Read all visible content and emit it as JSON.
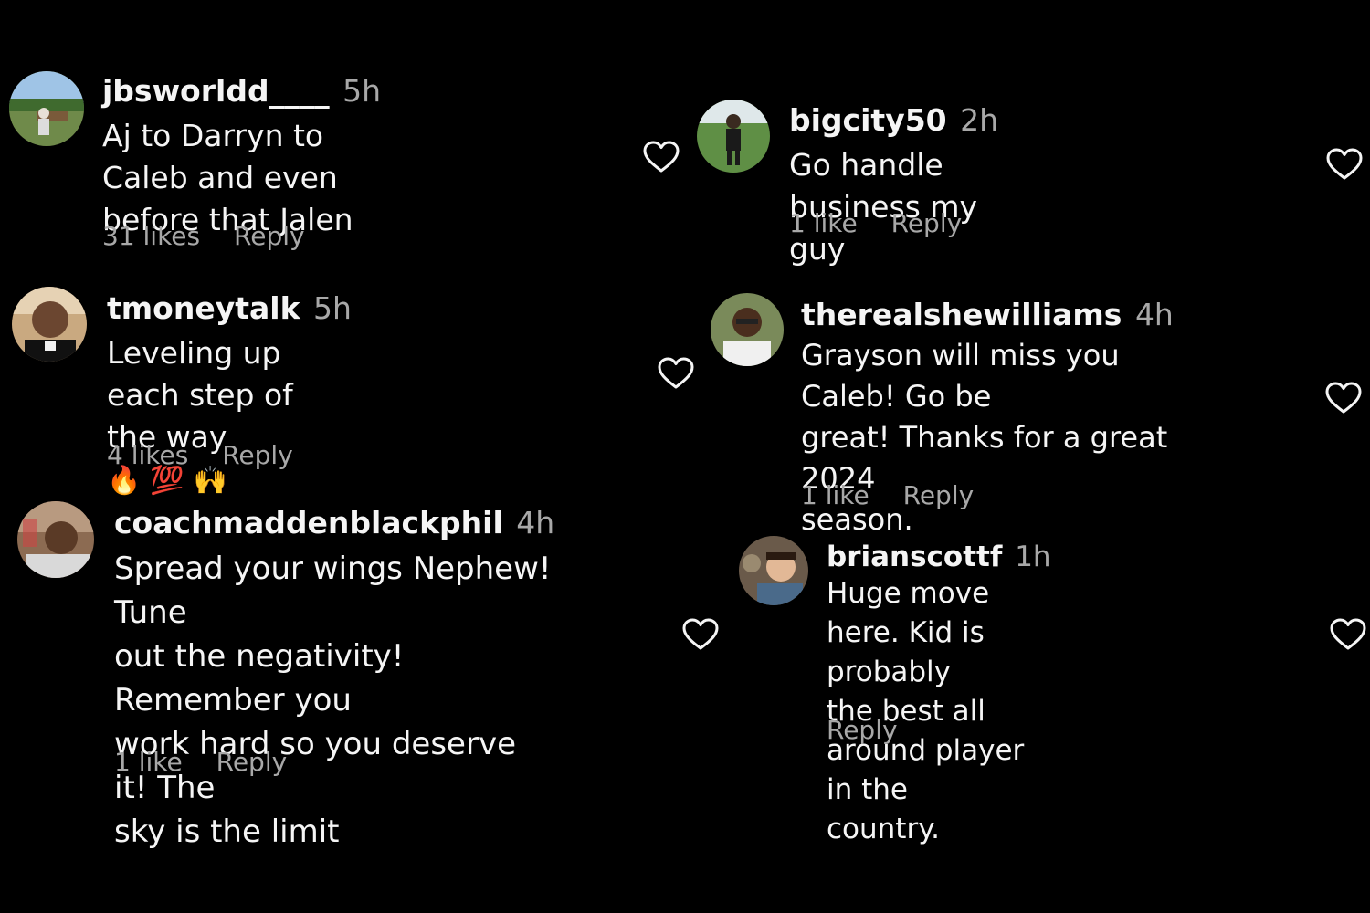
{
  "left": [
    {
      "username": "jbsworldd____",
      "time": "5h",
      "text_lines": [
        "Aj to Darryn to Caleb and even",
        "before that Jalen"
      ],
      "likes": "31 likes",
      "reply": "Reply"
    },
    {
      "username": "tmoneytalk",
      "time": "5h",
      "text_lines": [
        "Leveling up each step of the way"
      ],
      "emojis": "🔥💯🙌",
      "likes": "4 likes",
      "reply": "Reply"
    },
    {
      "username": "coachmaddenblackphil",
      "time": "4h",
      "text_lines": [
        "Spread your wings Nephew! Tune",
        "out the negativity! Remember you",
        "work hard so you deserve it! The",
        "sky is the limit"
      ],
      "likes": "1 like",
      "reply": "Reply"
    }
  ],
  "right": [
    {
      "username": "bigcity50",
      "time": "2h",
      "text_lines": [
        "Go handle business my guy"
      ],
      "likes": "1 like",
      "reply": "Reply"
    },
    {
      "username": "therealshewilliams",
      "time": "4h",
      "text_lines": [
        "Grayson will miss you Caleb! Go be",
        "great! Thanks for a great 2024",
        "season."
      ],
      "likes": "1 like",
      "reply": "Reply"
    },
    {
      "username": "brianscottf",
      "time": "1h",
      "text_lines": [
        "Huge move here. Kid is probably",
        "the best all around player in the",
        "country."
      ],
      "reply": "Reply"
    }
  ],
  "colors": {
    "background": "#000000",
    "primary_text": "#f5f5f5",
    "secondary_text": "#a8a8a8"
  },
  "icons": {
    "like": "heart-outline-icon",
    "avatar": "user-avatar"
  }
}
